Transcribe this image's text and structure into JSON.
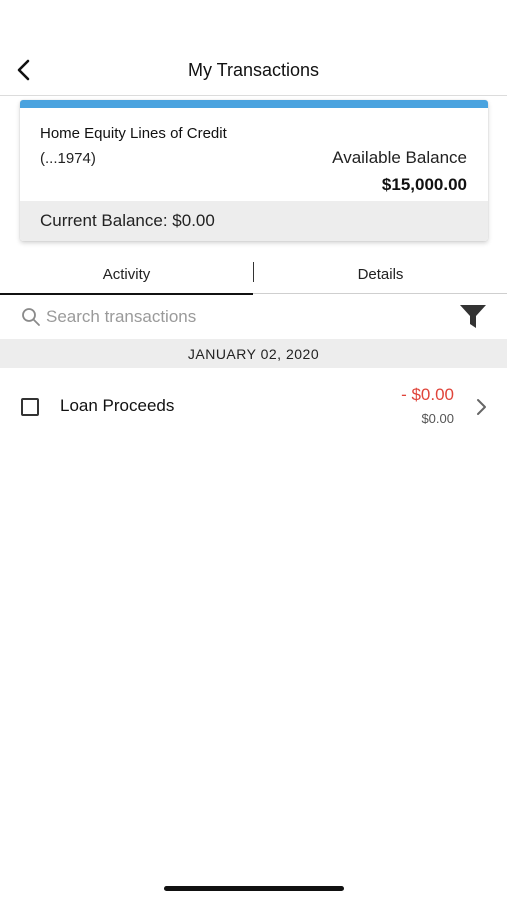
{
  "header": {
    "title": "My Transactions",
    "back_icon": "chevron-left-icon"
  },
  "account_card": {
    "accent_color": "#4aa3df",
    "name": "Home Equity Lines of Credit",
    "number": "(...1974)",
    "available_balance_label": "Available Balance",
    "available_balance": "$15,000.00",
    "current_balance_text": "Current Balance: $0.00"
  },
  "tabs": [
    {
      "label": "Activity",
      "active": true
    },
    {
      "label": "Details",
      "active": false
    }
  ],
  "search": {
    "placeholder": "Search transactions",
    "value": "",
    "icon": "search-icon",
    "filter_icon": "filter-icon"
  },
  "transactions": {
    "date_header": "JANUARY 02, 2020",
    "items": [
      {
        "description": "Loan Proceeds",
        "amount": "- $0.00",
        "amount_color": "#e0443a",
        "balance": "$0.00",
        "checked": false
      }
    ]
  }
}
